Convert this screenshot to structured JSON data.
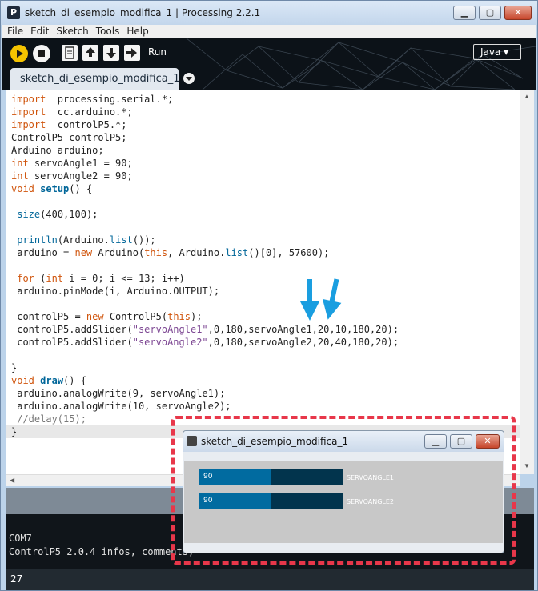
{
  "window": {
    "title": "sketch_di_esempio_modifica_1 | Processing 2.2.1",
    "minimize": "▁",
    "maximize": "▢",
    "close": "✕"
  },
  "menu": [
    "File",
    "Edit",
    "Sketch",
    "Tools",
    "Help"
  ],
  "toolbar": {
    "run_label": "Run",
    "mode": "Java ▾",
    "tab_name": "sketch_di_esempio_modifica_1"
  },
  "code": [
    {
      "parts": [
        [
          "kw",
          "import"
        ],
        [
          "",
          "  processing.serial.*;"
        ]
      ]
    },
    {
      "parts": [
        [
          "kw",
          "import"
        ],
        [
          "",
          "  cc.arduino.*;"
        ]
      ]
    },
    {
      "parts": [
        [
          "kw",
          "import"
        ],
        [
          "",
          "  controlP5.*;"
        ]
      ]
    },
    {
      "parts": [
        [
          "",
          "ControlP5 controlP5;"
        ]
      ]
    },
    {
      "parts": [
        [
          "",
          "Arduino arduino;"
        ]
      ]
    },
    {
      "parts": [
        [
          "kw",
          "int"
        ],
        [
          "",
          " servoAngle1 = 90;"
        ]
      ]
    },
    {
      "parts": [
        [
          "kw",
          "int"
        ],
        [
          "",
          " servoAngle2 = 90;"
        ]
      ]
    },
    {
      "parts": [
        [
          "kw",
          "void"
        ],
        [
          "",
          " "
        ],
        [
          "fnb",
          "setup"
        ],
        [
          "",
          "() {"
        ]
      ]
    },
    {
      "parts": [
        [
          "",
          ""
        ]
      ]
    },
    {
      "parts": [
        [
          "",
          " "
        ],
        [
          "fn",
          "size"
        ],
        [
          "",
          "(400,100);"
        ]
      ]
    },
    {
      "parts": [
        [
          "",
          ""
        ]
      ]
    },
    {
      "parts": [
        [
          "",
          " "
        ],
        [
          "fn",
          "println"
        ],
        [
          "",
          "(Arduino."
        ],
        [
          "fn",
          "list"
        ],
        [
          "",
          "());"
        ]
      ]
    },
    {
      "parts": [
        [
          "",
          " arduino = "
        ],
        [
          "kw",
          "new"
        ],
        [
          "",
          " Arduino("
        ],
        [
          "kw",
          "this"
        ],
        [
          "",
          ", Arduino."
        ],
        [
          "fn",
          "list"
        ],
        [
          "",
          "()[0], 57600);"
        ]
      ]
    },
    {
      "parts": [
        [
          "",
          ""
        ]
      ]
    },
    {
      "parts": [
        [
          "",
          " "
        ],
        [
          "kw",
          "for"
        ],
        [
          "",
          " ("
        ],
        [
          "kw",
          "int"
        ],
        [
          "",
          " i = 0; i <= 13; i++)"
        ]
      ]
    },
    {
      "parts": [
        [
          "",
          " arduino.pinMode(i, Arduino.OUTPUT);"
        ]
      ]
    },
    {
      "parts": [
        [
          "",
          ""
        ]
      ]
    },
    {
      "parts": [
        [
          "",
          " controlP5 = "
        ],
        [
          "kw",
          "new"
        ],
        [
          "",
          " ControlP5("
        ],
        [
          "kw",
          "this"
        ],
        [
          "",
          ");"
        ]
      ]
    },
    {
      "parts": [
        [
          "",
          " controlP5.addSlider("
        ],
        [
          "str",
          "\"servoAngle1\""
        ],
        [
          "",
          ",0,180,servoAngle1,20,10,180,20);"
        ]
      ]
    },
    {
      "parts": [
        [
          "",
          " controlP5.addSlider("
        ],
        [
          "str",
          "\"servoAngle2\""
        ],
        [
          "",
          ",0,180,servoAngle2,20,40,180,20);"
        ]
      ]
    },
    {
      "parts": [
        [
          "",
          ""
        ]
      ]
    },
    {
      "parts": [
        [
          "",
          "}"
        ]
      ]
    },
    {
      "parts": [
        [
          "kw",
          "void"
        ],
        [
          "",
          " "
        ],
        [
          "fnb",
          "draw"
        ],
        [
          "",
          "() {"
        ]
      ]
    },
    {
      "parts": [
        [
          "",
          " arduino.analogWrite(9, servoAngle1);"
        ]
      ]
    },
    {
      "parts": [
        [
          "",
          " arduino.analogWrite(10, servoAngle2);"
        ]
      ]
    },
    {
      "parts": [
        [
          "cm",
          " //delay(15);"
        ]
      ]
    },
    {
      "parts": [
        [
          "",
          "}"
        ]
      ]
    }
  ],
  "console": {
    "lines": [
      "COM7",
      "ControlP5 2.0.4 infos, comments, "
    ]
  },
  "status": {
    "line_number": "27"
  },
  "sketch_window": {
    "title": "sketch_di_esempio_modifica_1",
    "sliders": [
      {
        "name": "SERVOANGLE1",
        "value": "90",
        "fraction": 0.5
      },
      {
        "name": "SERVOANGLE2",
        "value": "90",
        "fraction": 0.5
      }
    ]
  },
  "colors": {
    "keyword": "#d0550d",
    "function": "#006699",
    "string": "#7d4793",
    "slider_fill": "#016ba0",
    "slider_bg": "#02344d",
    "annotation": "#e8374a",
    "arrow": "#1a9ee0"
  }
}
